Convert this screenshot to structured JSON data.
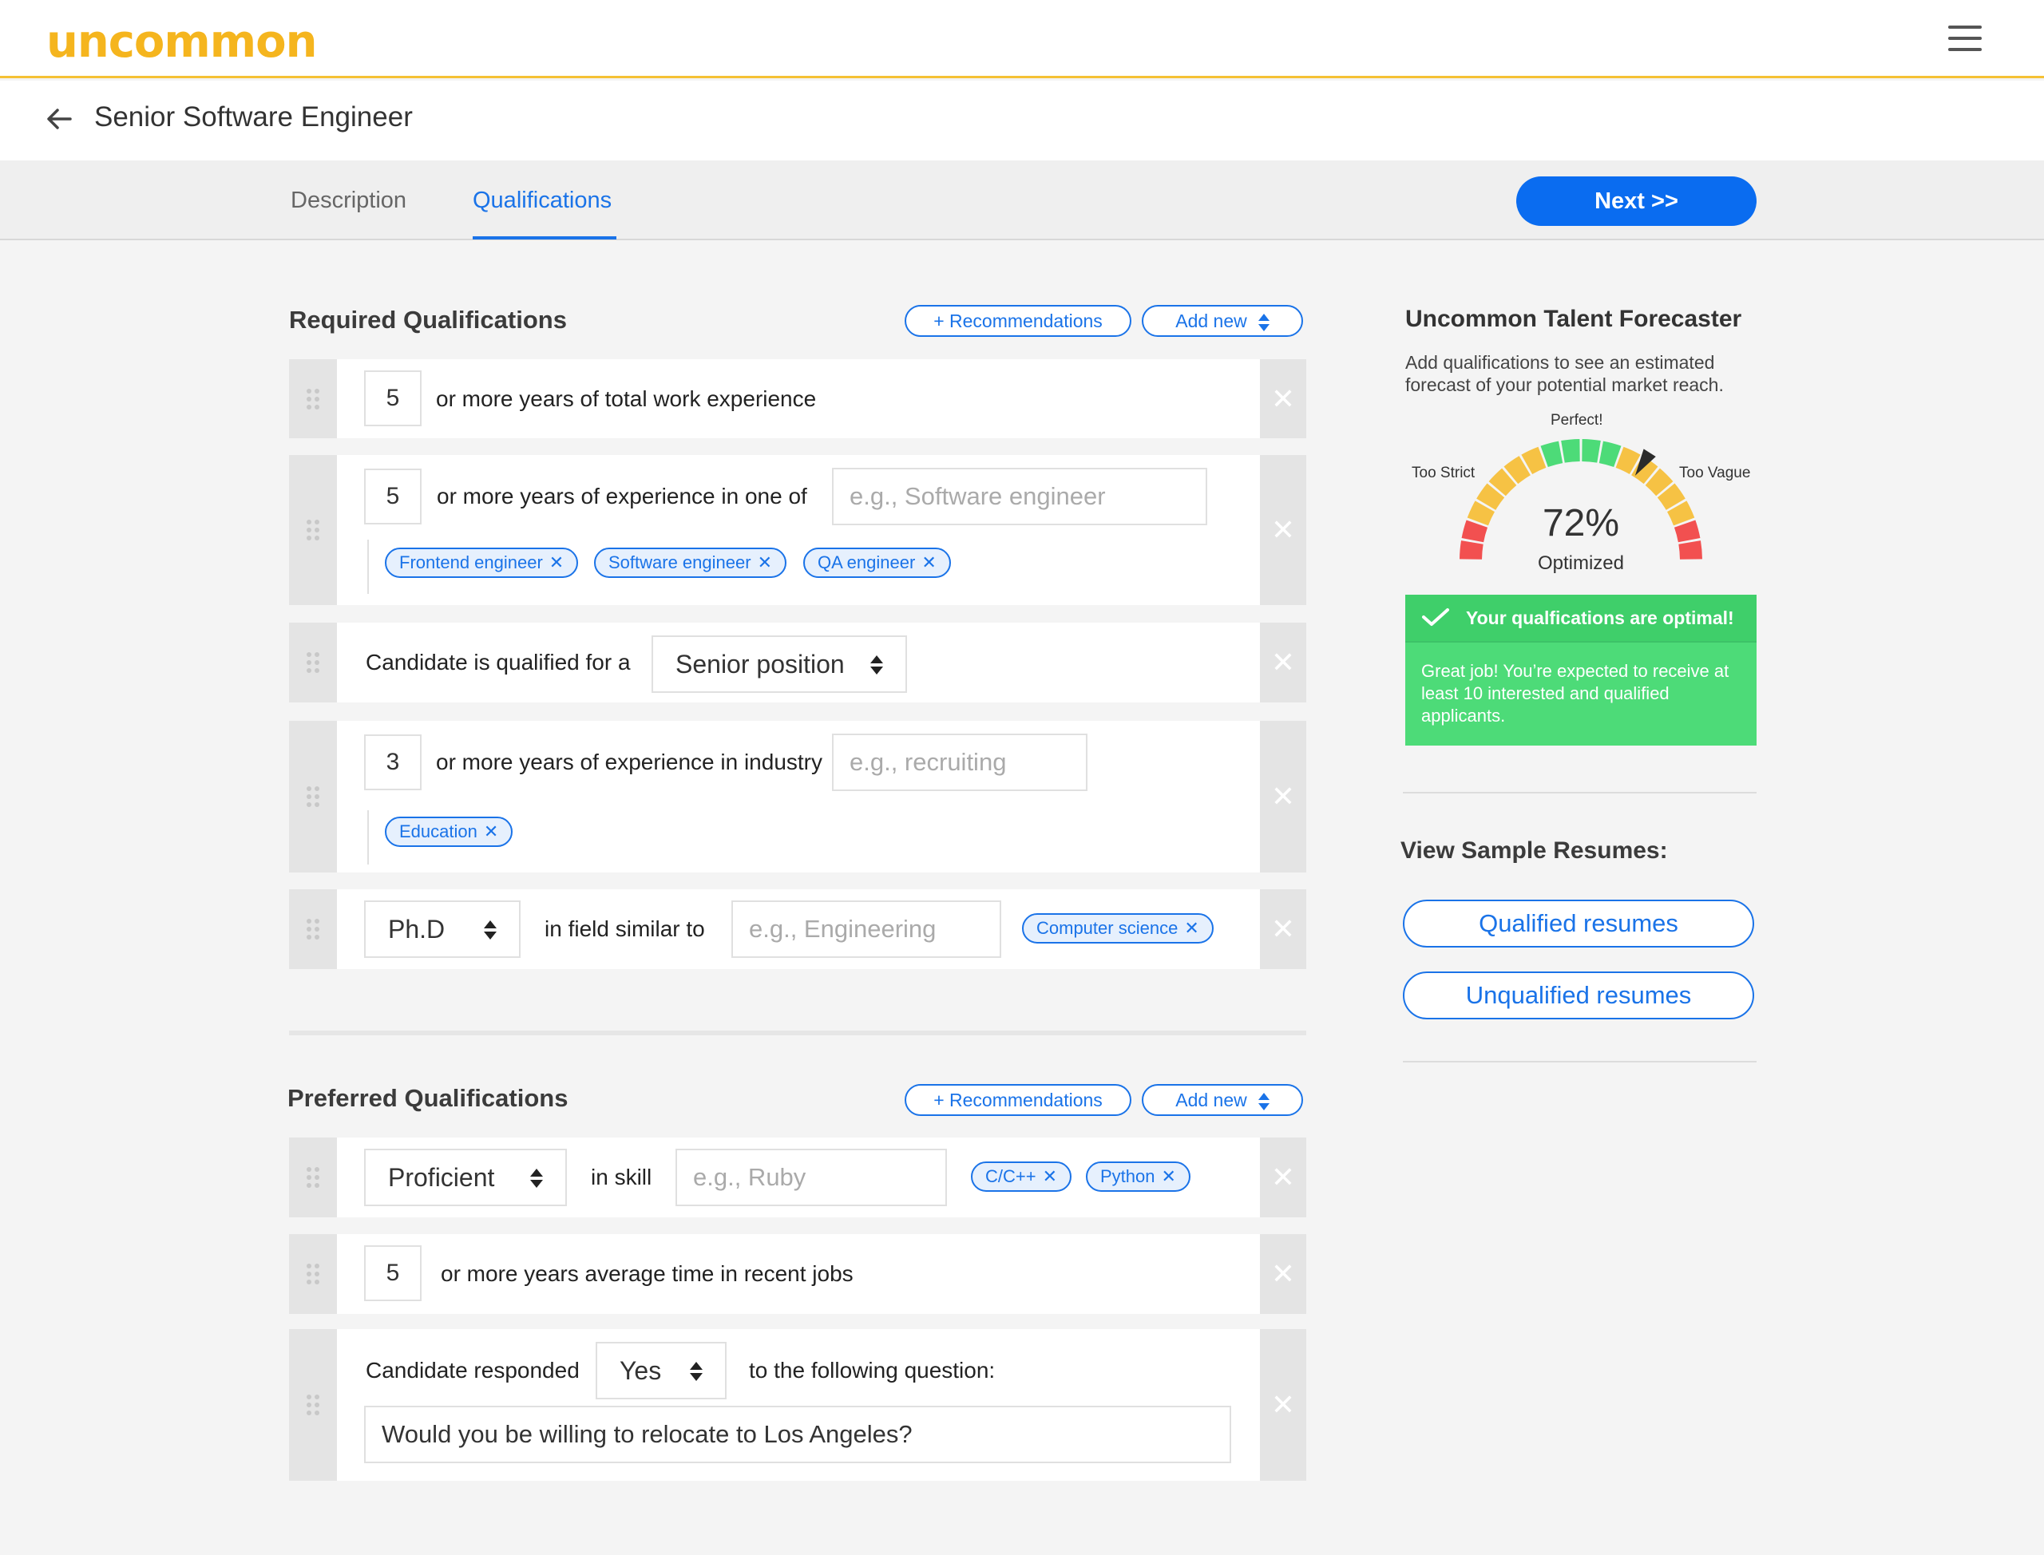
{
  "app": {
    "logo_text": "uncommon",
    "brand_color": "#f5b51e",
    "accent_color": "#1a73e8"
  },
  "header": {
    "page_title": "Senior Software Engineer"
  },
  "tabs": [
    {
      "label": "Description",
      "active": false
    },
    {
      "label": "Qualifications",
      "active": true
    }
  ],
  "next_label": "Next  >>",
  "required": {
    "title": "Required Qualifications",
    "recommendations_label": "+ Recommendations",
    "add_new_label": "Add new",
    "rows": [
      {
        "number": "5",
        "text": "or more years of total work experience"
      },
      {
        "number": "5",
        "text": "or more years of experience in one of",
        "placeholder": "e.g., Software engineer",
        "tags": [
          "Frontend engineer",
          "Software engineer",
          "QA engineer"
        ]
      },
      {
        "text": "Candidate is qualified for a",
        "select": "Senior position"
      },
      {
        "number": "3",
        "text": "or more years of experience in industry",
        "placeholder": "e.g., recruiting",
        "tags": [
          "Education"
        ]
      },
      {
        "select": "Ph.D",
        "text": "in field similar to",
        "placeholder": "e.g., Engineering",
        "tags": [
          "Computer science"
        ]
      }
    ]
  },
  "preferred": {
    "title": "Preferred Qualifications",
    "recommendations_label": "+ Recommendations",
    "add_new_label": "Add new",
    "rows": [
      {
        "select": "Proficient",
        "text": "in skill",
        "placeholder": "e.g., Ruby",
        "tags": [
          "C/C++",
          "Python"
        ]
      },
      {
        "number": "5",
        "text": "or more years average time in recent jobs"
      },
      {
        "text": "Candidate responded",
        "select": "Yes",
        "text2": "to the following question:",
        "question": "Would you be willing to relocate to Los Angeles?"
      }
    ]
  },
  "forecaster": {
    "title": "Uncommon Talent Forecaster",
    "description": "Add qualifications to see an estimated forecast of your potential market reach.",
    "label_left": "Too Strict",
    "label_top": "Perfect!",
    "label_right": "Too Vague",
    "percent": 72,
    "percent_text": "72%",
    "status_text": "Optimized",
    "optimal_title": "Your qualfications are optimal!",
    "optimal_body": "Great job! You’re expected to receive at least 10 interested and qualified applicants.",
    "success_color": "#4ddb78"
  },
  "samples": {
    "title": "View Sample Resumes:",
    "qualified_label": "Qualified resumes",
    "unqualified_label": "Unqualified resumes"
  }
}
